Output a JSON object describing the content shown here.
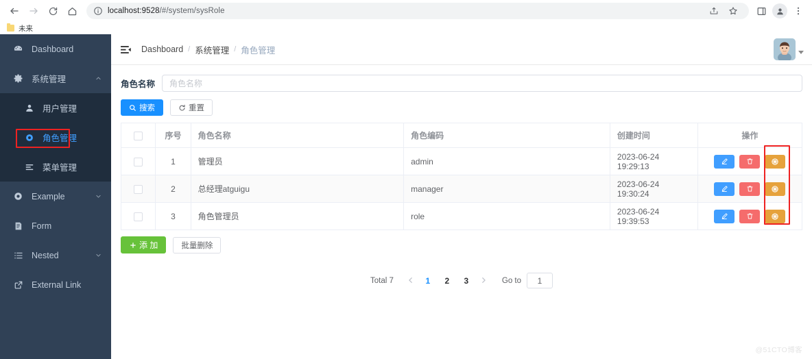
{
  "browser": {
    "url_host": "localhost:9528",
    "url_path": "/#/system/sysRole",
    "back_icon": "back-arrow-icon",
    "forward_icon": "forward-arrow-icon",
    "reload_icon": "reload-icon",
    "home_icon": "home-icon",
    "info_icon": "site-info-icon",
    "share_icon": "share-icon",
    "bookmark_icon": "star-icon",
    "sidepanel_icon": "side-panel-icon",
    "profile_icon": "profile-avatar-icon",
    "menu_icon": "three-dot-menu-icon",
    "bookmark_label": "未来"
  },
  "sidebar": {
    "items": [
      {
        "label": "Dashboard",
        "icon": "dashboard-icon",
        "expandable": false,
        "active": false
      },
      {
        "label": "系统管理",
        "icon": "gear-icon",
        "expandable": true,
        "expanded": true,
        "active": false
      },
      {
        "label": "Example",
        "icon": "component-icon",
        "expandable": true,
        "expanded": false,
        "active": false
      },
      {
        "label": "Form",
        "icon": "form-icon",
        "expandable": false,
        "active": false
      },
      {
        "label": "Nested",
        "icon": "nested-list-icon",
        "expandable": true,
        "expanded": false,
        "active": false
      },
      {
        "label": "External Link",
        "icon": "external-link-icon",
        "expandable": false,
        "active": false
      }
    ],
    "submenu": [
      {
        "label": "用户管理",
        "icon": "user-icon",
        "active": false
      },
      {
        "label": "角色管理",
        "icon": "role-circle-icon",
        "active": true,
        "highlighted": true
      },
      {
        "label": "菜单管理",
        "icon": "menu-list-icon",
        "active": false
      }
    ]
  },
  "navbar": {
    "hamburger_icon": "collapse-menu-icon",
    "breadcrumb": [
      {
        "label": "Dashboard",
        "current": false
      },
      {
        "label": "系统管理",
        "current": false
      },
      {
        "label": "角色管理",
        "current": true
      }
    ],
    "separator": "/",
    "avatar_icon": "user-avatar",
    "caret_icon": "chevron-down-icon"
  },
  "search": {
    "label": "角色名称",
    "placeholder": "角色名称",
    "value": "",
    "search_button": "搜索",
    "search_icon": "search-icon",
    "reset_button": "重置",
    "reset_icon": "refresh-icon"
  },
  "table": {
    "headers": [
      "",
      "序号",
      "角色名称",
      "角色编码",
      "创建时间",
      "操作"
    ],
    "rows": [
      {
        "index": "1",
        "name": "管理员",
        "code": "admin",
        "created": "2023-06-24 19:29:13"
      },
      {
        "index": "2",
        "name": "总经理atguigu",
        "code": "manager",
        "created": "2023-06-24 19:30:24"
      },
      {
        "index": "3",
        "name": "角色管理员",
        "code": "role",
        "created": "2023-06-24 19:39:53"
      }
    ],
    "op_icons": {
      "edit": "pencil-edit-icon",
      "delete": "trash-delete-icon",
      "auth": "assign-permission-icon"
    }
  },
  "actions": {
    "add_label": "添 加",
    "add_icon": "plus-icon",
    "batch_delete_label": "批量删除"
  },
  "pagination": {
    "total_label": "Total 7",
    "prev_icon": "chevron-left-icon",
    "next_icon": "chevron-right-icon",
    "pages": [
      "1",
      "2",
      "3"
    ],
    "active_page": "1",
    "goto_label": "Go to",
    "goto_value": "1"
  },
  "watermark": "@51CTO博客",
  "colors": {
    "sidebar_bg": "#304156",
    "submenu_bg": "#1f2d3d",
    "accent_blue": "#409eff",
    "primary_blue": "#1890ff",
    "danger_red": "#f56c6c",
    "warning_orange": "#e6a23c",
    "success_green": "#67c23a",
    "highlight_red": "#ee2222"
  }
}
